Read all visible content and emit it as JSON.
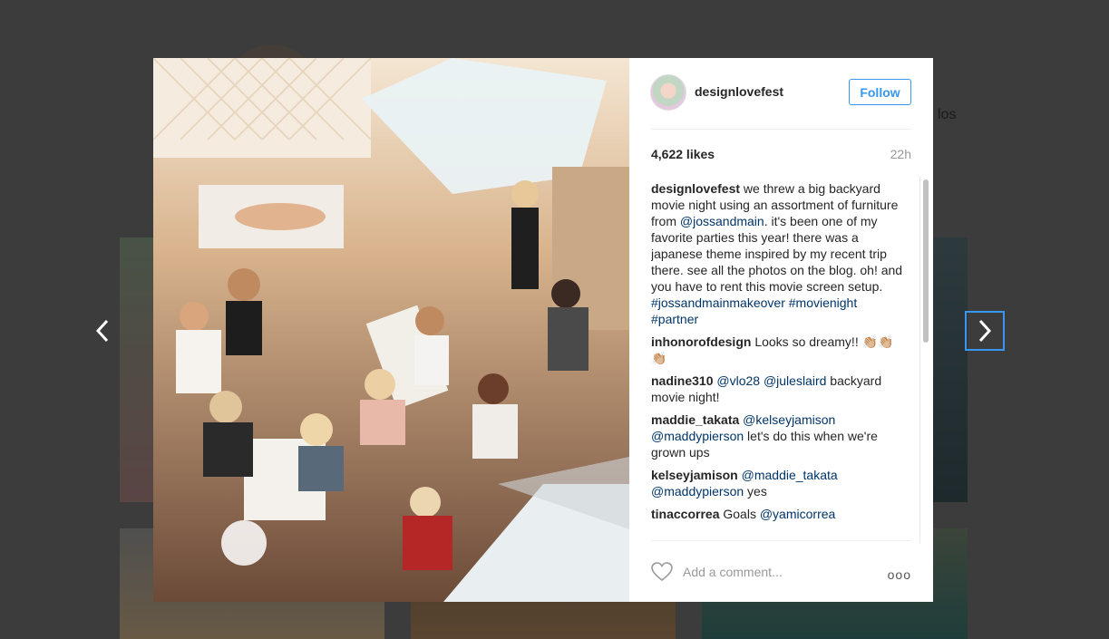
{
  "post": {
    "username": "designlovefest",
    "follow_label": "Follow",
    "likes": "4,622 likes",
    "time": "22h",
    "caption_user": "designlovefest",
    "caption_1": " we threw a big backyard movie night using an assortment of furniture from ",
    "caption_tag_1": "@jossandmain",
    "caption_2": ". it's been one of my favorite parties this year! there was a japanese theme inspired by my recent trip there. see all the photos on the blog. oh! and you have to rent this movie screen setup. ",
    "caption_hashtags": "#jossandmainmakeover #movienight #partner",
    "comments": [
      {
        "user": "inhonorofdesign",
        "text": " Looks so dreamy!! 👏🏼👏🏼👏🏼"
      },
      {
        "user": "nadine310",
        "tag": " @vlo28 @juleslaird",
        "text": " backyard movie night!"
      },
      {
        "user": "maddie_takata",
        "tag": " @kelseyjamison @maddypierson",
        "text": " let's do this when we're grown ups"
      },
      {
        "user": "kelseyjamison",
        "tag": " @maddie_takata @maddypierson",
        "text": " yes"
      },
      {
        "user": "tinaccorrea",
        "text": " Goals ",
        "tag": "@yamicorrea"
      }
    ],
    "add_comment_placeholder": "Add a comment...",
    "more_label": "ooo"
  },
  "background": {
    "partial_text": "los"
  },
  "icons": {
    "prev": "chevron-left-icon",
    "next": "chevron-right-icon",
    "heart": "heart-icon",
    "more": "more-options-icon"
  },
  "colors": {
    "accent": "#3897f0",
    "tag": "#003569",
    "text": "#262626",
    "muted": "#999999"
  }
}
